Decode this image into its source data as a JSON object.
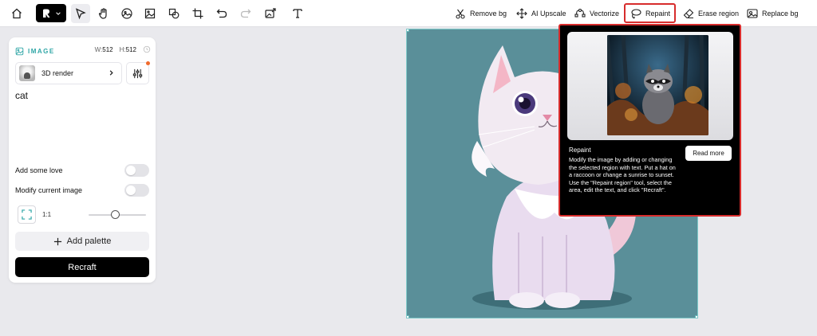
{
  "toolbar": {
    "tools_right": [
      {
        "label": "Remove bg",
        "icon": "scissors-icon"
      },
      {
        "label": "AI Upscale",
        "icon": "upscale-icon"
      },
      {
        "label": "Vectorize",
        "icon": "vectorize-icon"
      },
      {
        "label": "Repaint",
        "icon": "lasso-icon"
      },
      {
        "label": "Erase region",
        "icon": "eraser-icon"
      },
      {
        "label": "Replace bg",
        "icon": "replace-bg-icon"
      }
    ],
    "left_icons": [
      "home-icon",
      "logo-icon",
      "pointer-icon",
      "hand-icon",
      "ai-image-icon",
      "frame-image-icon",
      "shapes-icon",
      "crop-icon",
      "undo-icon",
      "redo-icon",
      "export-image-icon",
      "text-icon"
    ]
  },
  "panel": {
    "section_label": "IMAGE",
    "width_label": "W:",
    "width_value": "512",
    "height_label": "H:",
    "height_value": "512",
    "style_name": "3D render",
    "prompt": "cat",
    "toggles": [
      {
        "label": "Add some love",
        "on": false
      },
      {
        "label": "Modify current image",
        "on": false
      }
    ],
    "ratio": "1:1",
    "add_palette": "Add palette",
    "recraft": "Recraft"
  },
  "tooltip": {
    "title": "Repaint",
    "description": "Modify the image by adding or changing the selected region with text. Put a hat on a raccoon or change a sunrise to sunset. Use the \"Repaint region\" tool, select the area, edit the text, and click \"Recraft\".",
    "button": "Read more"
  },
  "colors": {
    "accent": "#2fa6a6",
    "highlight": "#d72c2c",
    "canvas_bg": "#5a8f99"
  }
}
